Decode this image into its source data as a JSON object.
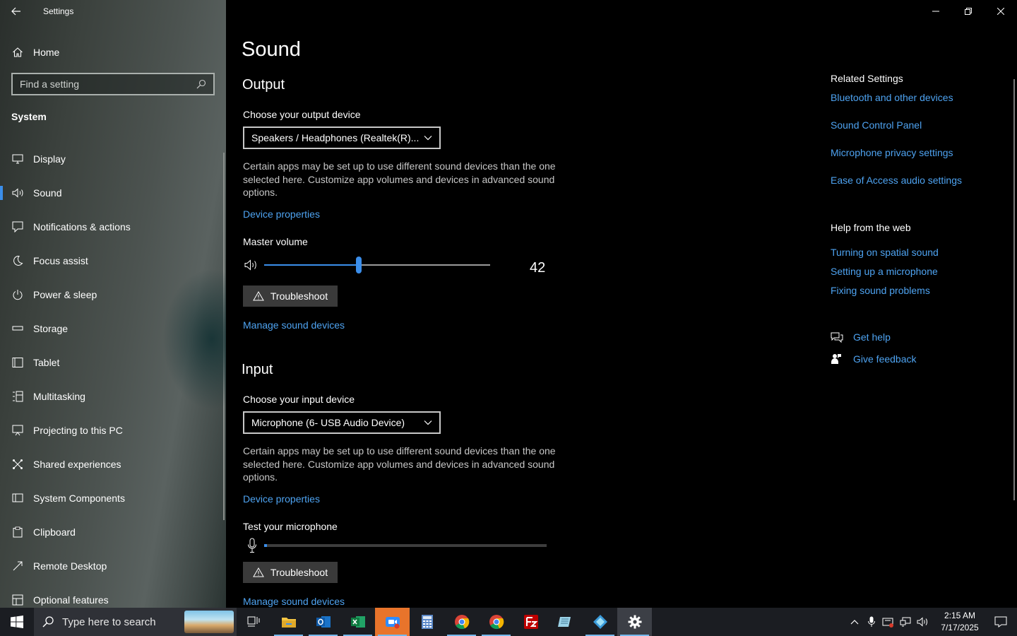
{
  "window": {
    "title": "Settings"
  },
  "sidebar": {
    "home_label": "Home",
    "search_placeholder": "Find a setting",
    "section": "System",
    "items": [
      {
        "label": "Display",
        "icon": "display-icon"
      },
      {
        "label": "Sound",
        "icon": "speaker-icon",
        "active": true
      },
      {
        "label": "Notifications & actions",
        "icon": "notification-icon"
      },
      {
        "label": "Focus assist",
        "icon": "moon-icon"
      },
      {
        "label": "Power & sleep",
        "icon": "power-icon"
      },
      {
        "label": "Storage",
        "icon": "storage-icon"
      },
      {
        "label": "Tablet",
        "icon": "tablet-icon"
      },
      {
        "label": "Multitasking",
        "icon": "multitasking-icon"
      },
      {
        "label": "Projecting to this PC",
        "icon": "projecting-icon"
      },
      {
        "label": "Shared experiences",
        "icon": "shared-icon"
      },
      {
        "label": "System Components",
        "icon": "components-icon"
      },
      {
        "label": "Clipboard",
        "icon": "clipboard-icon"
      },
      {
        "label": "Remote Desktop",
        "icon": "remote-desktop-icon"
      },
      {
        "label": "Optional features",
        "icon": "optional-features-icon"
      }
    ]
  },
  "main": {
    "title": "Sound",
    "output": {
      "heading": "Output",
      "choose_label": "Choose your output device",
      "device": "Speakers / Headphones (Realtek(R)...",
      "description": "Certain apps may be set up to use different sound devices than the one selected here. Customize app volumes and devices in advanced sound options.",
      "device_properties": "Device properties",
      "master_volume_label": "Master volume",
      "volume": 42,
      "troubleshoot": "Troubleshoot",
      "manage": "Manage sound devices"
    },
    "input": {
      "heading": "Input",
      "choose_label": "Choose your input device",
      "device": "Microphone (6- USB Audio Device)",
      "description": "Certain apps may be set up to use different sound devices than the one selected here. Customize app volumes and devices in advanced sound options.",
      "device_properties": "Device properties",
      "test_label": "Test your microphone",
      "mic_level": 0.01,
      "troubleshoot": "Troubleshoot",
      "manage": "Manage sound devices"
    }
  },
  "related": {
    "heading": "Related Settings",
    "links": [
      "Bluetooth and other devices",
      "Sound Control Panel",
      "Microphone privacy settings",
      "Ease of Access audio settings"
    ],
    "help_heading": "Help from the web",
    "help_links": [
      "Turning on spatial sound",
      "Setting up a microphone",
      "Fixing sound problems"
    ],
    "get_help": "Get help",
    "give_feedback": "Give feedback"
  },
  "taskbar": {
    "search_placeholder": "Type here to search",
    "time": "2:15 AM",
    "date": "7/17/2025"
  },
  "colors": {
    "accent": "#3b8eea",
    "link": "#4ea3f1"
  }
}
